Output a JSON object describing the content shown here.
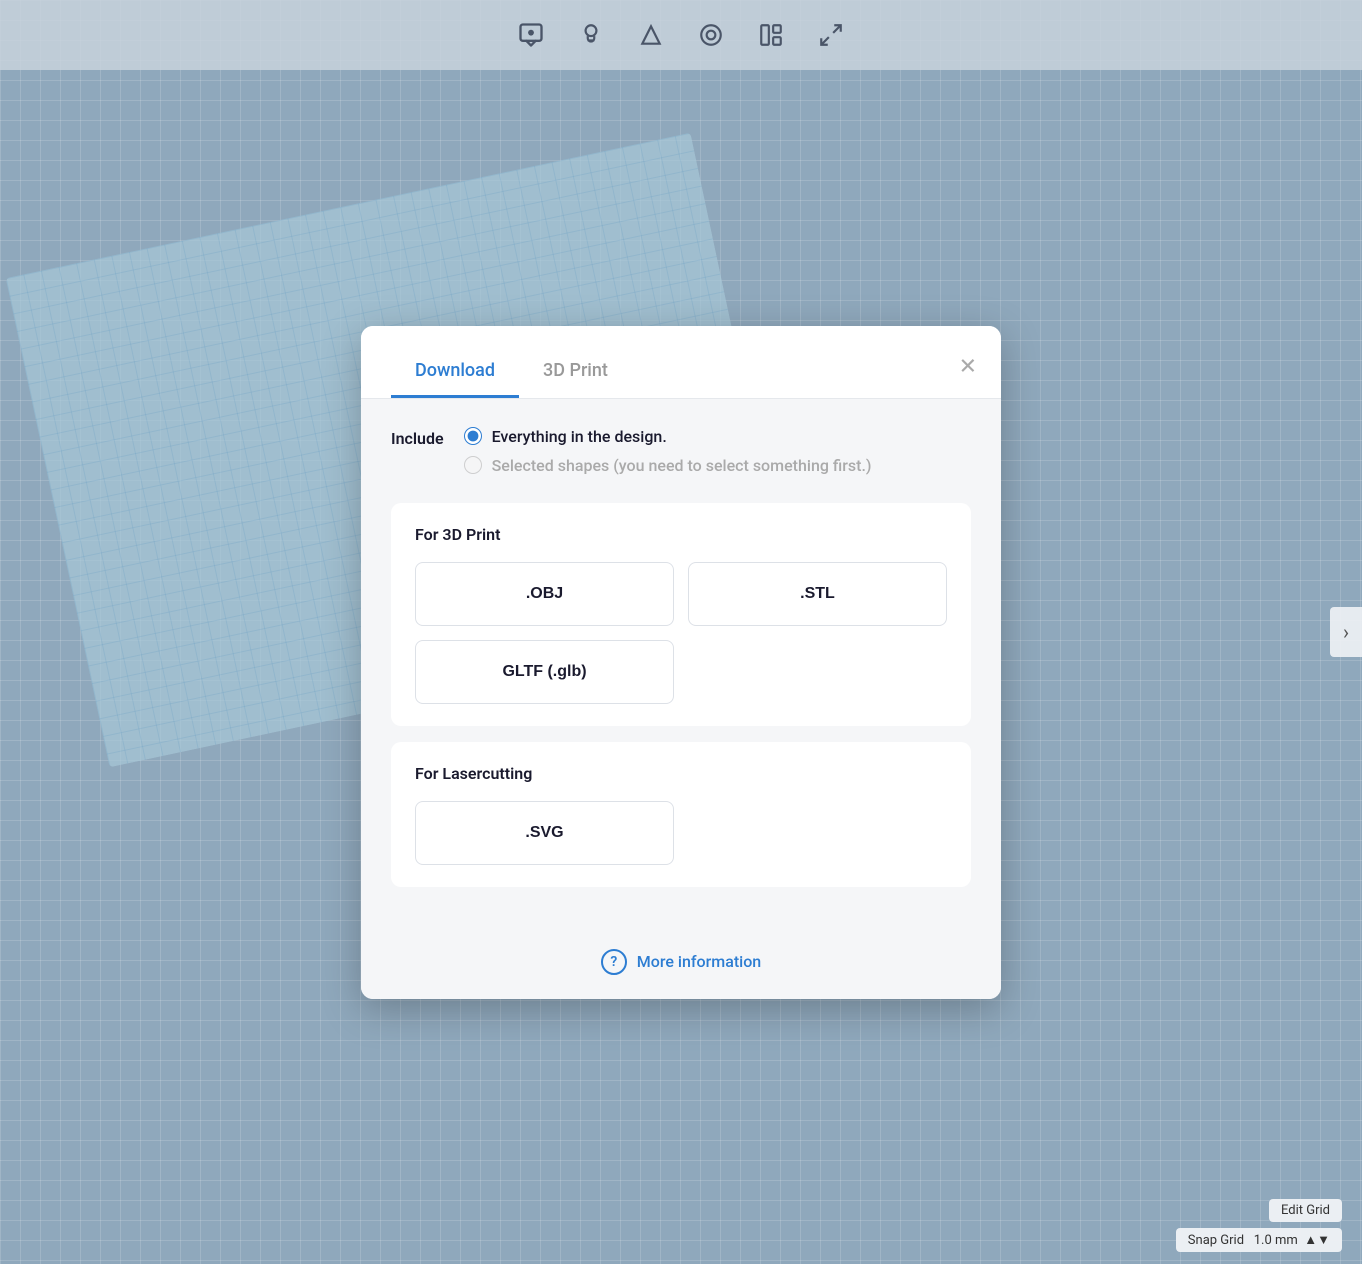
{
  "toolbar": {
    "icons": [
      {
        "name": "comment-icon",
        "symbol": "💬"
      },
      {
        "name": "bulb-icon",
        "symbol": "💡"
      },
      {
        "name": "shape-icon",
        "symbol": "🔷"
      },
      {
        "name": "view-icon",
        "symbol": "🔲"
      },
      {
        "name": "layout-icon",
        "symbol": "📋"
      },
      {
        "name": "resize-icon",
        "symbol": "◧"
      }
    ]
  },
  "canvas": {
    "bg_color": "#8fa8bc"
  },
  "status_bar": {
    "edit_grid_label": "Edit Grid",
    "snap_grid_label": "Snap Grid",
    "snap_grid_value": "1.0 mm"
  },
  "chevron": {
    "symbol": "›"
  },
  "modal": {
    "tabs": [
      {
        "label": "Download",
        "active": true
      },
      {
        "label": "3D Print",
        "active": false
      }
    ],
    "close_symbol": "✕",
    "include_label": "Include",
    "radio_options": [
      {
        "label": "Everything in the design.",
        "checked": true,
        "disabled": false
      },
      {
        "label": "Selected shapes (you need to select something first.)",
        "checked": false,
        "disabled": true
      }
    ],
    "sections": [
      {
        "title": "For 3D Print",
        "buttons": [
          {
            "label": ".OBJ",
            "wide": false
          },
          {
            "label": ".STL",
            "wide": false
          },
          {
            "label": "GLTF (.glb)",
            "wide": true
          }
        ]
      },
      {
        "title": "For Lasercutting",
        "buttons": [
          {
            "label": ".SVG",
            "wide": false
          }
        ]
      }
    ],
    "more_info": {
      "icon_symbol": "?",
      "label": "More information"
    }
  }
}
